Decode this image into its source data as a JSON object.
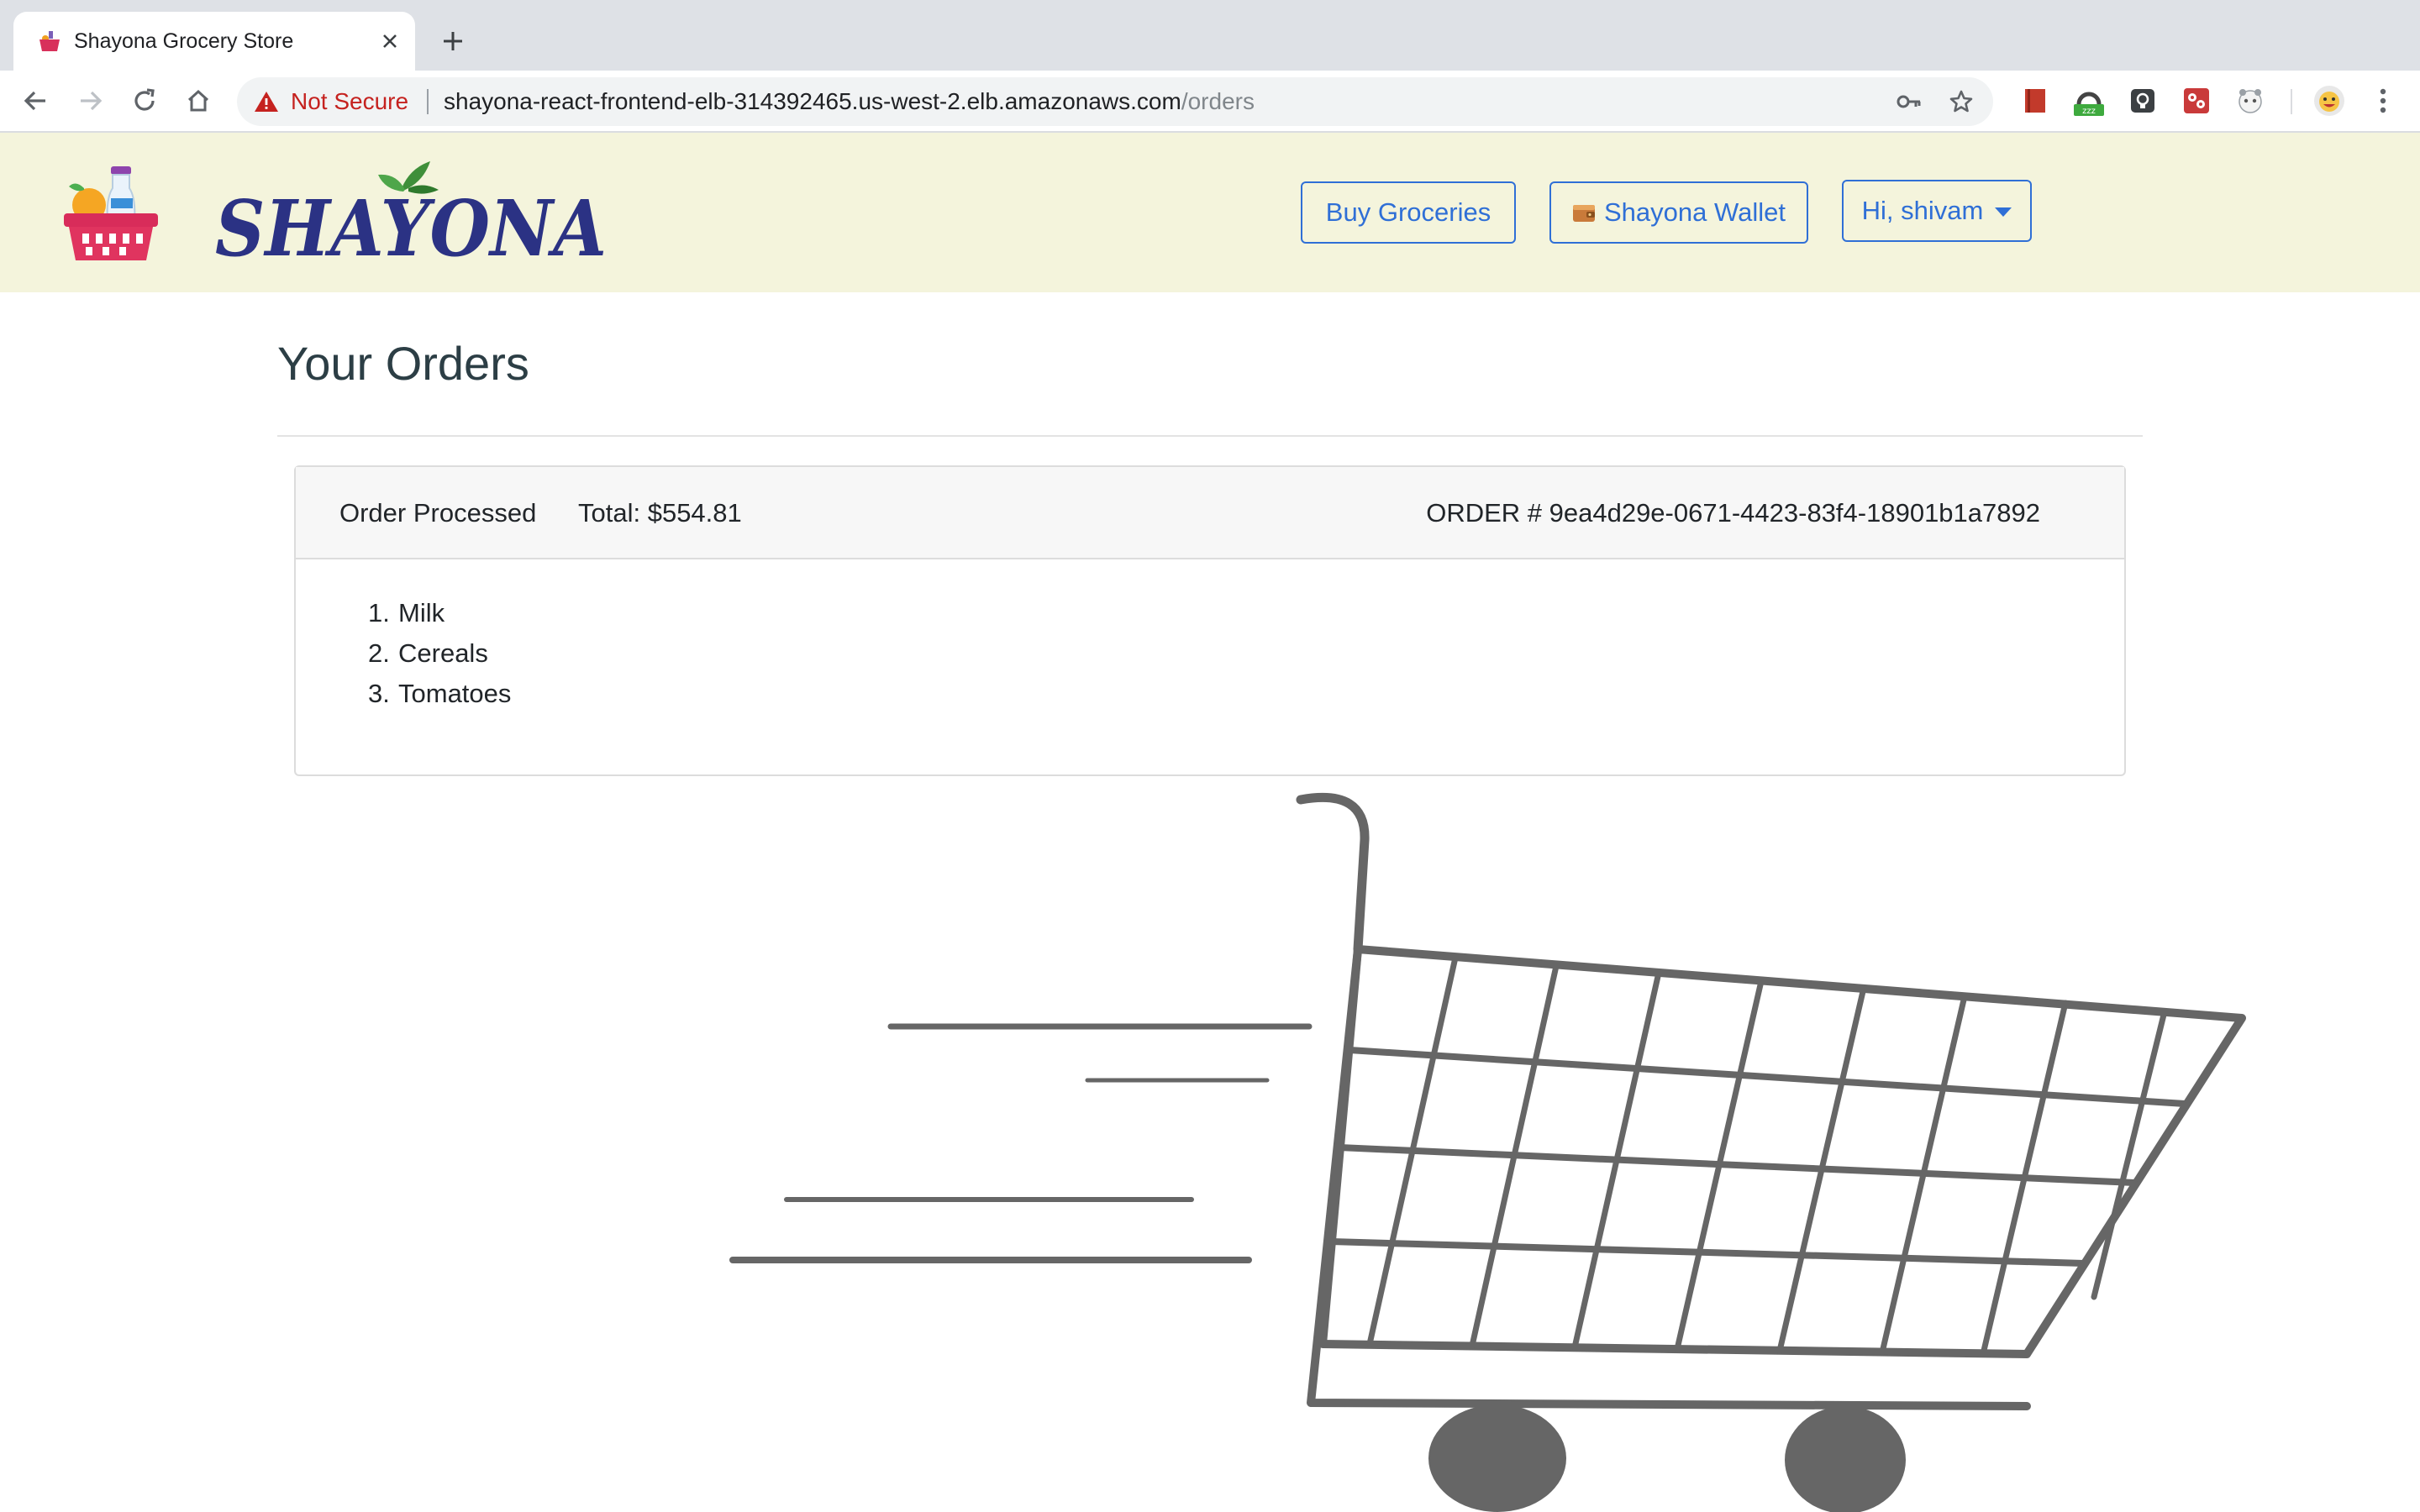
{
  "browser": {
    "tab_title": "Shayona Grocery Store",
    "security_label": "Not Secure",
    "url_host": "shayona-react-frontend-elb-314392465.us-west-2.elb.amazonaws.com",
    "url_path": "/orders"
  },
  "navbar": {
    "brand": "SHAYONA",
    "buy_groceries": "Buy Groceries",
    "wallet": "Shayona Wallet",
    "user_menu": "Hi, shivam"
  },
  "page": {
    "title": "Your Orders"
  },
  "orders": [
    {
      "status": "Order Processed",
      "total": "Total: $554.81",
      "order_number": "ORDER # 9ea4d29e-0671-4423-83f4-18901b1a7892",
      "items": [
        {
          "num": "1.",
          "name": "Milk"
        },
        {
          "num": "2.",
          "name": "Cereals"
        },
        {
          "num": "3.",
          "name": "Tomatoes"
        }
      ]
    }
  ],
  "colors": {
    "navbar_bg": "#f4f4dc",
    "accent_blue": "#2f6fd6",
    "brand_navy": "#2b3284",
    "not_secure_red": "#c5221f"
  },
  "icons": [
    "back-icon",
    "forward-icon",
    "reload-icon",
    "home-icon",
    "warning-icon",
    "key-icon",
    "star-icon",
    "wallet-icon",
    "more-icon"
  ]
}
